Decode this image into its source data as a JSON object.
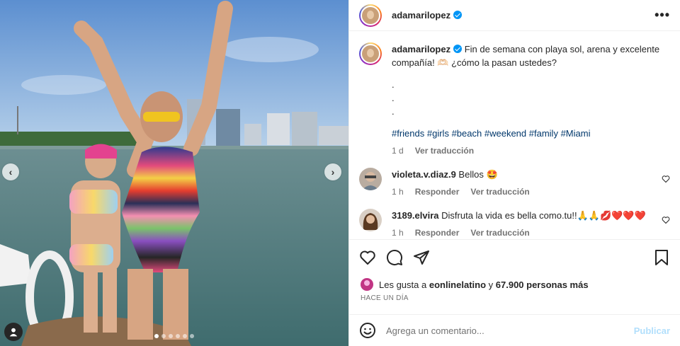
{
  "post": {
    "username": "adamarilopez",
    "caption_text": "Fin de semana con playa sol, arena y excelente compañía! 🫶🏻 ¿cómo la pasan ustedes?",
    "caption_dots": [
      ".",
      ".",
      "."
    ],
    "hashtags": [
      "#friends",
      "#girls",
      "#beach",
      "#weekend",
      "#family",
      "#Miami"
    ],
    "caption_age": "1 d",
    "see_translation": "Ver traducción"
  },
  "comments": [
    {
      "username": "violeta.v.diaz.9",
      "text": "Bellos 🤩",
      "age": "1 h",
      "reply": "Responder",
      "translate": "Ver traducción"
    },
    {
      "username": "3189.elvira",
      "text": "Disfruta la vida es bella como.tu!!🙏🙏💋❤️❤️❤️",
      "age": "1 h",
      "reply": "Responder",
      "translate": "Ver traducción"
    }
  ],
  "likes": {
    "prefix": "Les gusta a",
    "by": "eonlinelatino",
    "mid": "y",
    "count": "67.900 personas más"
  },
  "time_ago": "HACE UN DÍA",
  "composer": {
    "placeholder": "Agrega un comentario...",
    "publish": "Publicar"
  },
  "carousel": {
    "total": 6,
    "active": 0,
    "prev_icon": "chevron-left-icon",
    "next_icon": "chevron-right-icon"
  },
  "colors": {
    "link": "#00376b",
    "meta": "#737373",
    "publish": "#b2dffc",
    "verified": "#0095f6"
  }
}
